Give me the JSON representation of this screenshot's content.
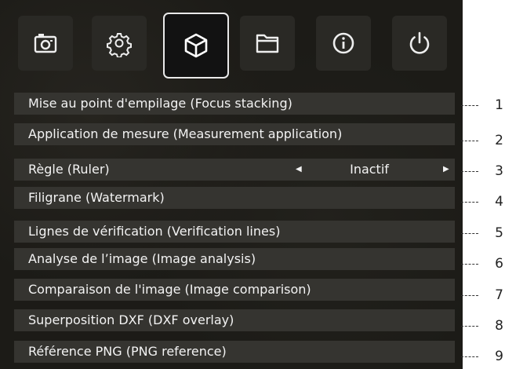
{
  "tabs": [
    {
      "icon": "camera-icon"
    },
    {
      "icon": "gear-icon"
    },
    {
      "icon": "cube-icon",
      "active": true
    },
    {
      "icon": "folder-icon"
    },
    {
      "icon": "info-icon"
    },
    {
      "icon": "power-icon"
    }
  ],
  "menu": {
    "items": [
      {
        "label": "Mise au point d'empilage (Focus stacking)"
      },
      {
        "label": "Application de mesure (Measurement application)"
      },
      {
        "label": "Règle (Ruler)",
        "value": "Inactif"
      },
      {
        "label": "Filigrane (Watermark)"
      },
      {
        "label": "Lignes de vérification (Verification lines)"
      },
      {
        "label": "Analyse de l’image (Image analysis)"
      },
      {
        "label": "Comparaison de l'image (Image comparison)"
      },
      {
        "label": "Superposition DXF (DXF overlay)"
      },
      {
        "label": "Référence PNG (PNG reference)"
      }
    ]
  },
  "callouts": [
    "1",
    "2",
    "3",
    "4",
    "5",
    "6",
    "7",
    "8",
    "9"
  ],
  "colors": {
    "panel": "#1c1b17",
    "row": "#353430",
    "tab": "#2a2925",
    "text": "#f3f3f3",
    "active_border": "#e9e9e9"
  }
}
